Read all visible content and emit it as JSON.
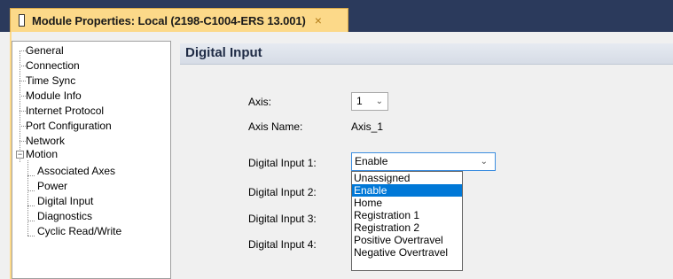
{
  "window": {
    "tab_title": "Module Properties: Local (2198-C1004-ERS 13.001)",
    "close_glyph": "×"
  },
  "tree": {
    "items": [
      {
        "label": "General"
      },
      {
        "label": "Connection"
      },
      {
        "label": "Time Sync"
      },
      {
        "label": "Module Info"
      },
      {
        "label": "Internet Protocol"
      },
      {
        "label": "Port Configuration"
      },
      {
        "label": "Network"
      },
      {
        "label": "Motion",
        "expander": "−"
      },
      {
        "label": "Associated Axes"
      },
      {
        "label": "Power"
      },
      {
        "label": "Digital Input"
      },
      {
        "label": "Diagnostics"
      },
      {
        "label": "Cyclic Read/Write"
      }
    ]
  },
  "panel": {
    "title": "Digital Input",
    "axis_label": "Axis:",
    "axis_value": "1",
    "axis_name_label": "Axis Name:",
    "axis_name_value": "Axis_1",
    "digital_inputs": [
      {
        "label": "Digital Input 1:",
        "value": "Enable"
      },
      {
        "label": "Digital Input 2:"
      },
      {
        "label": "Digital Input 3:"
      },
      {
        "label": "Digital Input 4:"
      }
    ],
    "dropdown_options": [
      "Unassigned",
      "Enable",
      "Home",
      "Registration 1",
      "Registration 2",
      "Positive Overtravel",
      "Negative Overtravel"
    ],
    "selected_option": "Enable"
  },
  "colors": {
    "title_bar": "#2b3a5c",
    "tab": "#fcd989",
    "selection": "#0078d7"
  }
}
